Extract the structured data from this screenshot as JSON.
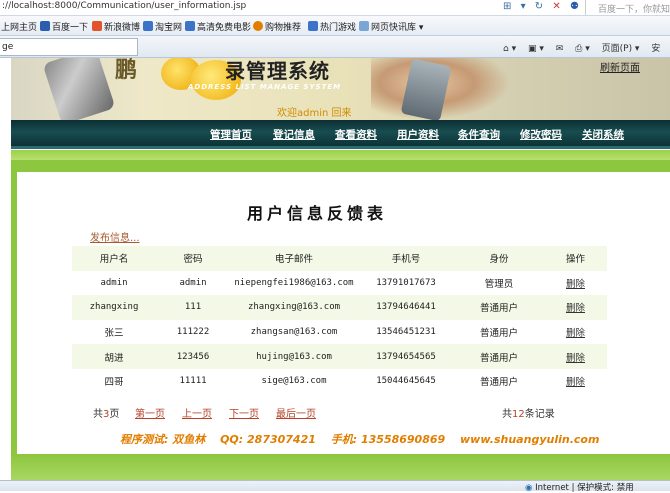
{
  "browser": {
    "url": "://localhost:8000/Communication/user_information.jsp",
    "search_placeholder": "百度一下，你就知道",
    "favorites": [
      "上网主页",
      "百度一下",
      "新浪微博",
      "淘宝网",
      "高清免费电影",
      "购物推荐",
      "热门游戏",
      "网页快讯库 ▾"
    ],
    "tab_label": "ge",
    "tools": [
      "⌂ ▾",
      "▣ ▾",
      "✉",
      "⎙ ▾",
      "页面(P) ▾",
      "安"
    ],
    "status_text": "Internet | 保护模式: 禁用"
  },
  "banner": {
    "big_text": "鹏",
    "title": "录管理系统",
    "subtitle": "ADDRESS   LIST MANAGE SYSTEM",
    "welcome": "欢迎admin 回来",
    "refresh": "刷新页面"
  },
  "nav": {
    "items": [
      "管理首页",
      "登记信息",
      "查看资料",
      "用户资料",
      "条件查询",
      "修改密码",
      "关闭系统"
    ]
  },
  "main": {
    "title": "用户信息反馈表",
    "publish_link": "发布信息...",
    "columns": [
      "用户名",
      "密码",
      "电子邮件",
      "手机号",
      "身份",
      "操作"
    ],
    "rows": [
      {
        "username": "admin",
        "password": "admin",
        "email": "niepengfei1986@163.com",
        "phone": "13791017673",
        "role": "管理员",
        "action": "删除"
      },
      {
        "username": "zhangxing",
        "password": "111",
        "email": "zhangxing@163.com",
        "phone": "13794646441",
        "role": "普通用户",
        "action": "删除"
      },
      {
        "username": "张三",
        "password": "111222",
        "email": "zhangsan@163.com",
        "phone": "13546451231",
        "role": "普通用户",
        "action": "删除"
      },
      {
        "username": "胡进",
        "password": "123456",
        "email": "hujing@163.com",
        "phone": "13794654565",
        "role": "普通用户",
        "action": "删除"
      },
      {
        "username": "四哥",
        "password": "11111",
        "email": "sige@163.com",
        "phone": "15044645645",
        "role": "普通用户",
        "action": "删除"
      }
    ],
    "pager": {
      "prefix": "共",
      "pages": "3",
      "suffix": "页",
      "first": "第一页",
      "prev": "上一页",
      "next": "下一页",
      "last": "最后一页"
    },
    "total": {
      "prefix": "共",
      "count": "12",
      "suffix": "条记录"
    },
    "footer": [
      "程序测试: 双鱼林",
      "QQ: 287307421",
      "手机: 13558690869",
      "www.shuangyulin.com"
    ]
  }
}
